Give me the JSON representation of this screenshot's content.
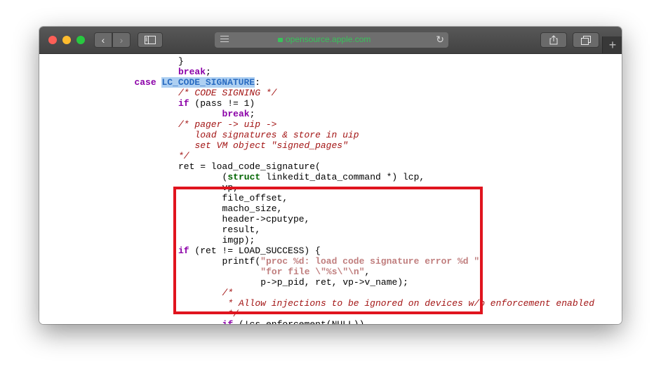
{
  "browser": {
    "url": "opensource.apple.com",
    "icons": [
      "back-icon",
      "forward-icon",
      "sidebar-icon",
      "reader-icon",
      "lock-icon",
      "reload-icon",
      "share-icon",
      "tabs-icon",
      "plus-icon"
    ],
    "new_tab_glyph": "+"
  },
  "code_lines": [
    {
      "indent": 0,
      "segs": [
        {
          "t": "}",
          "c": "p"
        }
      ]
    },
    {
      "indent": 0,
      "segs": [
        {
          "t": "break",
          "c": "kw"
        },
        {
          "t": ";",
          "c": "p"
        }
      ]
    },
    {
      "indent": -8,
      "segs": [
        {
          "t": "case ",
          "c": "kw"
        },
        {
          "t": "LC_CODE_SIGNATURE",
          "c": "hl"
        },
        {
          "t": ":",
          "c": "p"
        }
      ]
    },
    {
      "indent": 0,
      "segs": [
        {
          "t": "/* CODE SIGNING */",
          "c": "cm"
        }
      ]
    },
    {
      "indent": 0,
      "segs": [
        {
          "t": "if",
          "c": "kw"
        },
        {
          "t": " (pass != 1)",
          "c": "p"
        }
      ]
    },
    {
      "indent": 8,
      "segs": [
        {
          "t": "break",
          "c": "kw"
        },
        {
          "t": ";",
          "c": "p"
        }
      ]
    },
    {
      "indent": 0,
      "segs": [
        {
          "t": "/* pager -> uip ->",
          "c": "cm"
        }
      ]
    },
    {
      "indent": 3,
      "segs": [
        {
          "t": "load signatures & store in uip",
          "c": "cm"
        }
      ]
    },
    {
      "indent": 3,
      "segs": [
        {
          "t": "set VM object \"signed_pages\"",
          "c": "cm"
        }
      ]
    },
    {
      "indent": 0,
      "segs": [
        {
          "t": "*/",
          "c": "cm"
        }
      ]
    },
    {
      "indent": 0,
      "segs": [
        {
          "t": "ret = load_code_signature(",
          "c": "p"
        }
      ]
    },
    {
      "indent": 8,
      "segs": [
        {
          "t": "(",
          "c": "p"
        },
        {
          "t": "struct",
          "c": "kw2"
        },
        {
          "t": " linkedit_data_command *) lcp,",
          "c": "p"
        }
      ]
    },
    {
      "indent": 8,
      "segs": [
        {
          "t": "vp,",
          "c": "p"
        }
      ]
    },
    {
      "indent": 8,
      "segs": [
        {
          "t": "file_offset,",
          "c": "p"
        }
      ]
    },
    {
      "indent": 8,
      "segs": [
        {
          "t": "macho_size,",
          "c": "p"
        }
      ]
    },
    {
      "indent": 8,
      "segs": [
        {
          "t": "header->cputype,",
          "c": "p"
        }
      ]
    },
    {
      "indent": 8,
      "segs": [
        {
          "t": "result,",
          "c": "p"
        }
      ]
    },
    {
      "indent": 8,
      "segs": [
        {
          "t": "imgp);",
          "c": "p"
        }
      ]
    },
    {
      "indent": 0,
      "segs": [
        {
          "t": "if",
          "c": "kw"
        },
        {
          "t": " (ret != LOAD_SUCCESS) {",
          "c": "p"
        }
      ]
    },
    {
      "indent": 8,
      "segs": [
        {
          "t": "printf(",
          "c": "p"
        },
        {
          "t": "\"proc %d: load code signature error %d \"",
          "c": "str"
        }
      ]
    },
    {
      "indent": 15,
      "segs": [
        {
          "t": "\"for file \\\"%s\\\"\\n\"",
          "c": "str"
        },
        {
          "t": ",",
          "c": "p"
        }
      ]
    },
    {
      "indent": 15,
      "segs": [
        {
          "t": "p->p_pid, ret, vp->v_name);",
          "c": "p"
        }
      ]
    },
    {
      "indent": 8,
      "segs": [
        {
          "t": "/*",
          "c": "cm"
        }
      ]
    },
    {
      "indent": 8,
      "segs": [
        {
          "t": " * Allow injections to be ignored on devices w/o enforcement enabled",
          "c": "cm"
        }
      ]
    },
    {
      "indent": 8,
      "segs": [
        {
          "t": " */",
          "c": "cm"
        }
      ]
    },
    {
      "indent": 8,
      "segs": [
        {
          "t": "if",
          "c": "kw"
        },
        {
          "t": " (!cs_enforcement(NULL))",
          "c": "p"
        }
      ]
    }
  ],
  "highlight": {
    "label": "highlighted-load-signature-block",
    "color": "#e0141e"
  }
}
